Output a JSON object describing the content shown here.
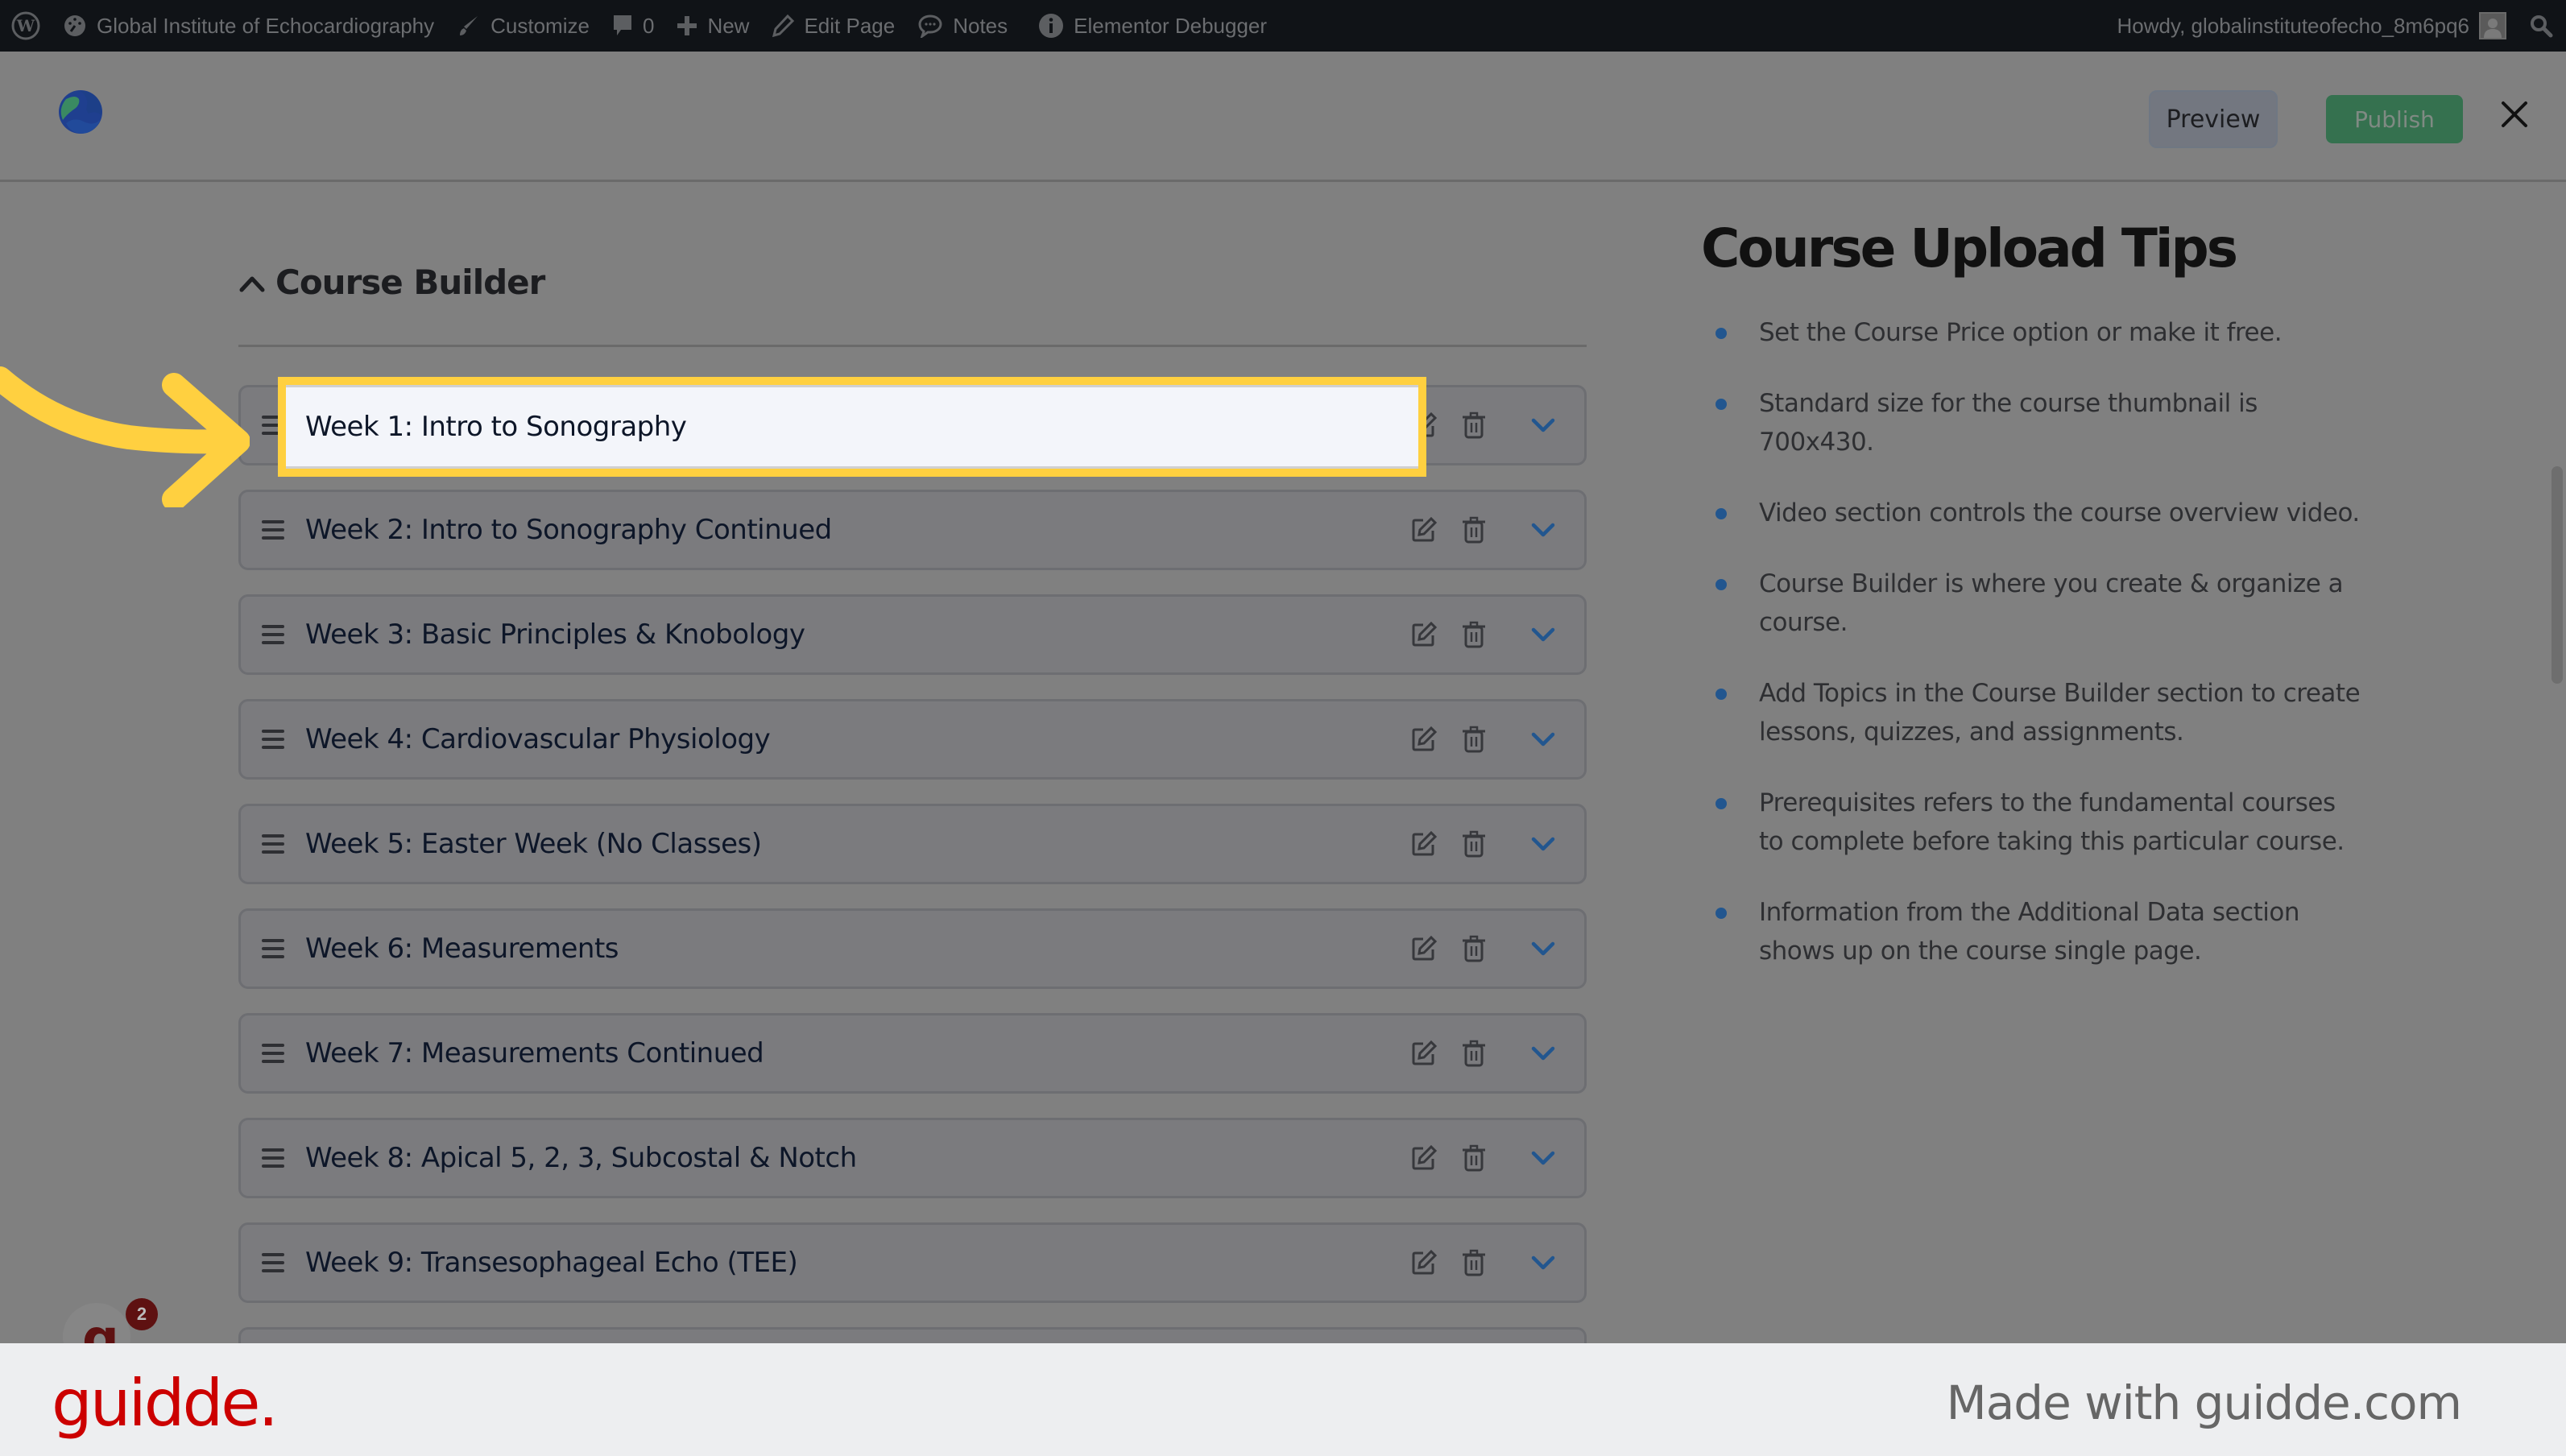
{
  "adminbar": {
    "site_name": "Global Institute of Echocardiography",
    "customize": "Customize",
    "comments_count": "0",
    "new": "New",
    "edit_page": "Edit Page",
    "notes": "Notes",
    "debugger": "Elementor Debugger",
    "howdy": "Howdy, globalinstituteofecho_8m6pq6"
  },
  "header": {
    "preview": "Preview",
    "publish": "Publish"
  },
  "course_builder": {
    "title": "Course Builder",
    "topics": [
      {
        "title": "Week 1: Intro to Sonography"
      },
      {
        "title": "Week 2: Intro to Sonography Continued"
      },
      {
        "title": "Week 3: Basic Principles & Knobology"
      },
      {
        "title": "Week 4: Cardiovascular Physiology"
      },
      {
        "title": "Week 5: Easter Week (No Classes)"
      },
      {
        "title": "Week 6: Measurements"
      },
      {
        "title": "Week 7: Measurements Continued"
      },
      {
        "title": "Week 8: Apical 5, 2, 3, Subcostal & Notch"
      },
      {
        "title": "Week 9: Transesophageal Echo (TEE)"
      }
    ]
  },
  "tips": {
    "title": "Course Upload Tips",
    "items": [
      "Set the Course Price option or make it free.",
      "Standard size for the course thumbnail is 700x430.",
      "Video section controls the course overview video.",
      "Course Builder is where you create & organize a course.",
      "Add Topics in the Course Builder section to create lessons, quizzes, and assignments.",
      "Prerequisites refers to the fundamental courses to complete before taking this particular course.",
      "Information from the Additional Data section shows up on the course single page."
    ]
  },
  "fab": {
    "letter": "g",
    "badge": "2"
  },
  "footer": {
    "logo": "guidde.",
    "made_with": "Made with guidde.com"
  },
  "colors": {
    "highlight": "#ffd040",
    "publish": "#35714f",
    "bullet": "#22568f",
    "chevron": "#22568f",
    "guidde_red": "#cc0000"
  }
}
